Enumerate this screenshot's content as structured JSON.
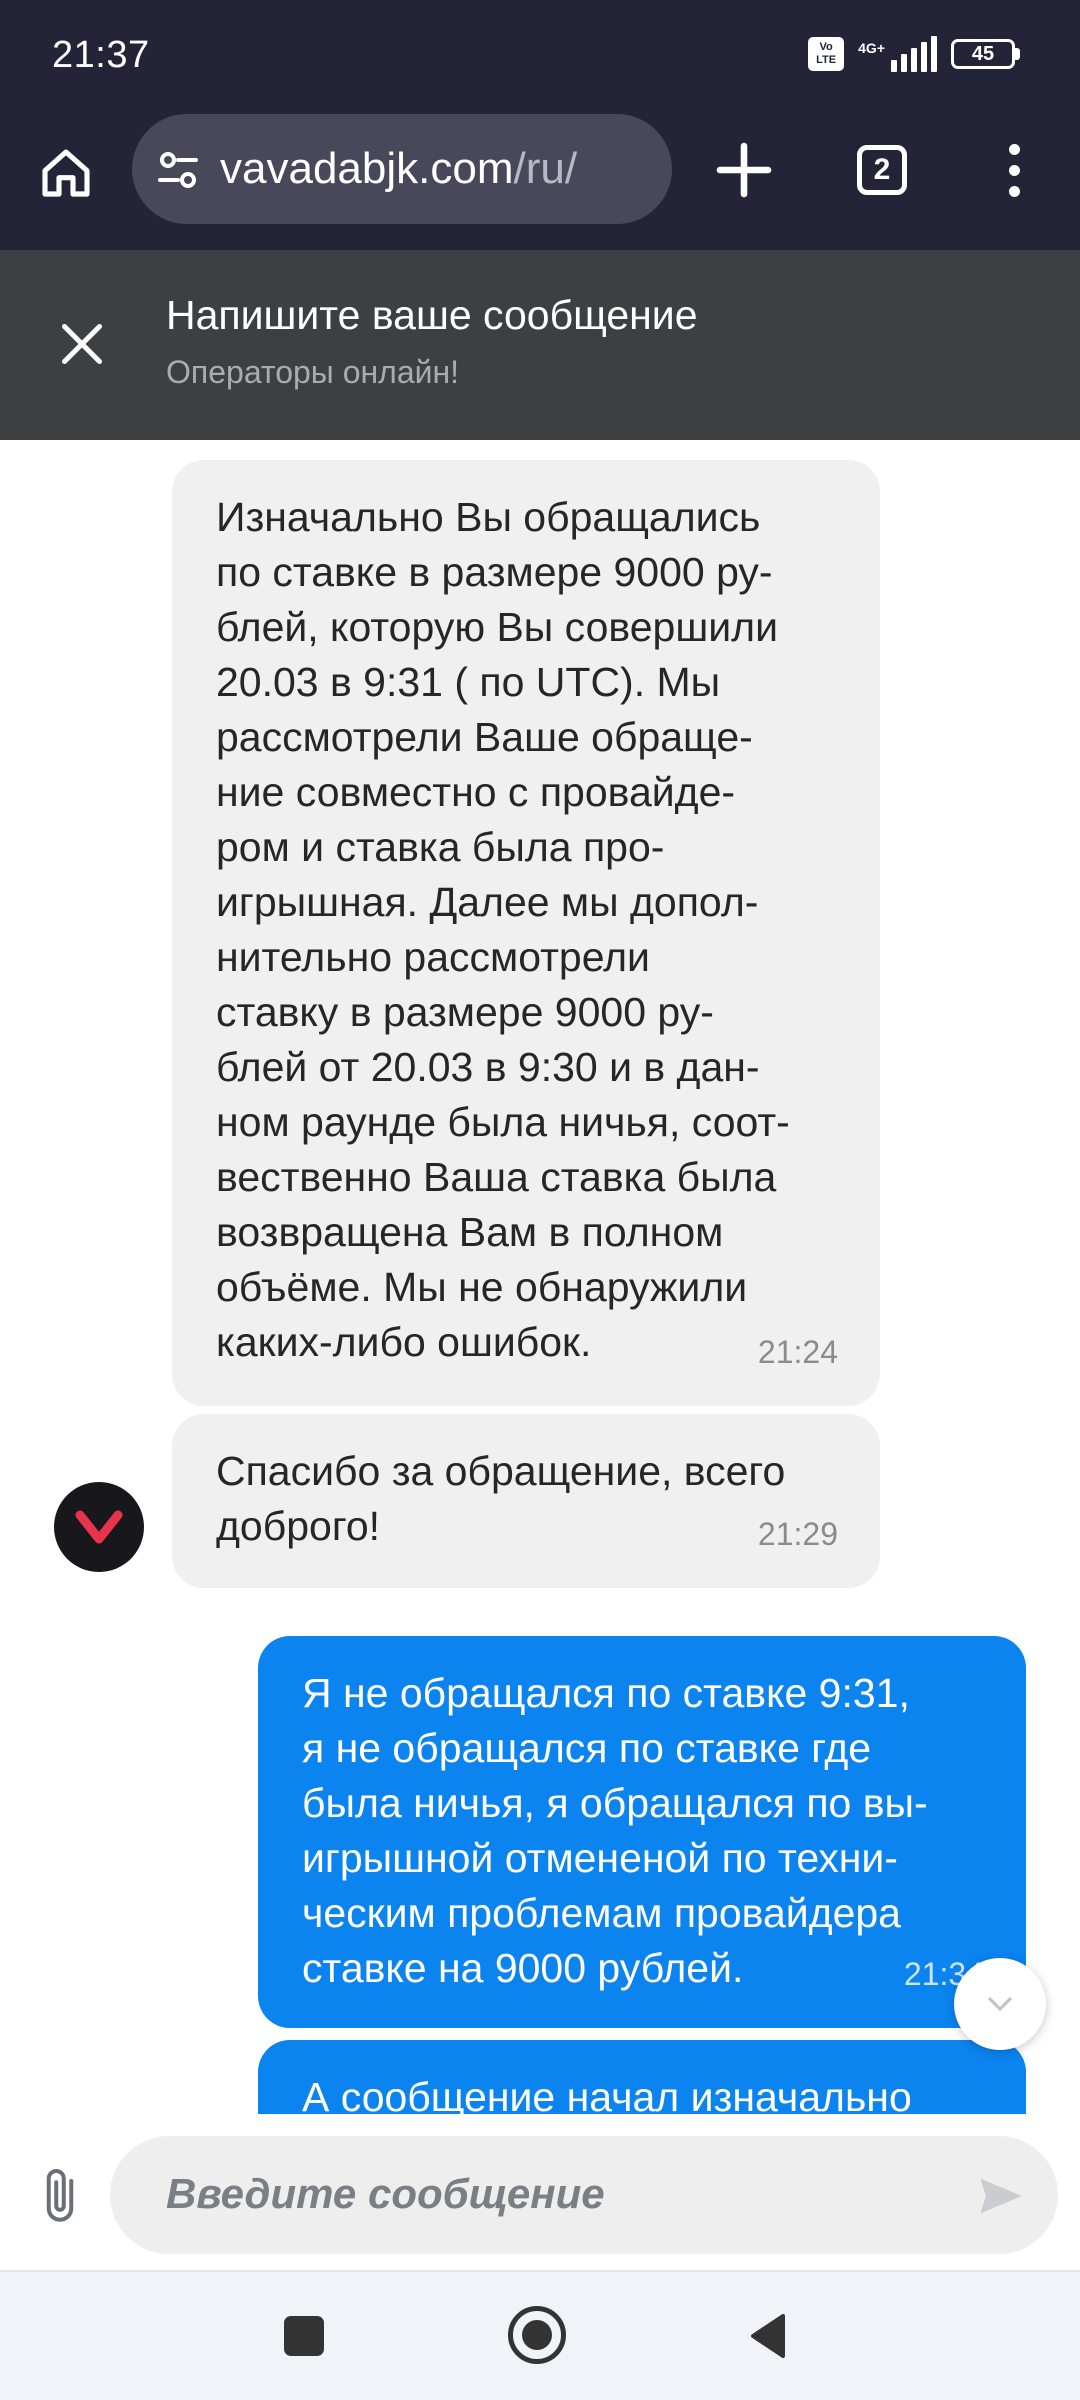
{
  "status_bar": {
    "time": "21:37",
    "volte_label": "Vo LTE",
    "network_label": "4G+",
    "battery_level": "45"
  },
  "browser": {
    "url_host": "vavadabjk.com",
    "url_path": "/ru/",
    "tab_count": "2",
    "icons": [
      "home-icon",
      "site-settings-icon",
      "new-tab-icon",
      "tabs-icon",
      "more-vert-icon"
    ]
  },
  "chat_header": {
    "title": "Напишите ваше сообщение",
    "subtitle": "Операторы онлайн!"
  },
  "messages": [
    {
      "direction": "incoming",
      "text": "Изначально Вы обращались\nпо ставке в размере 9000 ру-\nблей, которую Вы совершили\n20.03 в 9:31 ( по UTC). Мы\nрассмотрели Ваше обраще-\nние совместно с провайде-\nром и ставка была про-\nигрышная. Далее мы допол-\nнительно рассмотрели\nставку в размере 9000 ру-\nблей от 20.03 в 9:30 и в дан-\nном раунде была ничья, соот-\nвественно Ваша ставка была\nвозвращена Вам в полном\nобъёме. Мы не обнаружили\nкаких-либо ошибок.",
      "time": "21:24"
    },
    {
      "direction": "incoming",
      "text": "Спасибо за обращение, всего\nдоброго!",
      "time": "21:29"
    },
    {
      "direction": "outgoing",
      "text": "Я не обращался по ставке 9:31,\nя не обращался по ставке где\nбыла ничья, я обращался по вы-\nигрышной отмененой по техни-\nческим проблемам провайдера\nставке на 9000 рублей.",
      "time": "21:34"
    },
    {
      "direction": "outgoing",
      "text": "А сообщение начал изначально",
      "time": ""
    }
  ],
  "input": {
    "placeholder": "Введите сообщение"
  },
  "colors": {
    "top_bar": "#242438",
    "chat_header": "#3d4043",
    "incoming_bubble": "#f0f0f0",
    "outgoing_bubble": "#0b84f0",
    "brand_accent": "#e8334a"
  }
}
